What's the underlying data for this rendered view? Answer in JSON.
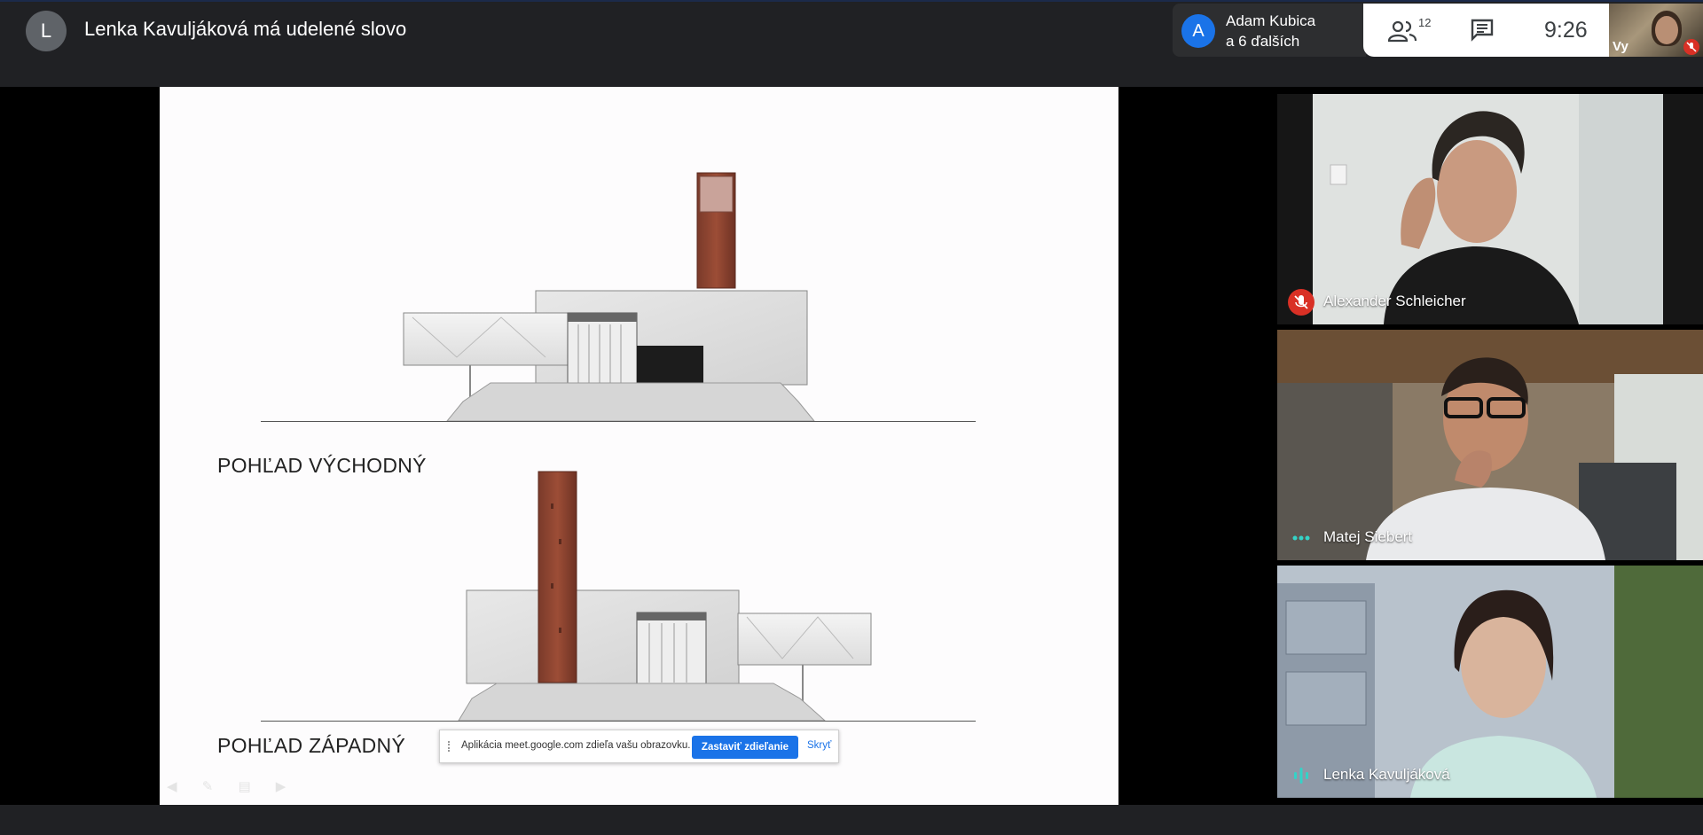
{
  "topbar": {
    "presenter_initial": "L",
    "presenter_text": "Lenka Kavuljáková má udelené slovo",
    "participants_avatar_initial": "A",
    "participants_name": "Adam Kubica",
    "participants_others": "a 6 ďalších",
    "people_count": "12",
    "clock": "9:26",
    "self_label": "Vy"
  },
  "slide": {
    "label_east": "POHĽAD VÝCHODNÝ",
    "label_west": "POHĽAD ZÁPADNÝ"
  },
  "share_bar": {
    "message": "Aplikácia meet.google.com zdieľa vašu obrazovku.",
    "stop_label": "Zastaviť zdieľanie",
    "hide_label": "Skryť"
  },
  "tiles": [
    {
      "name": "Alexander Schleicher",
      "status": "muted"
    },
    {
      "name": "Matej Siebert",
      "status": "idle"
    },
    {
      "name": "Lenka Kavuljáková",
      "status": "speaking"
    }
  ],
  "colors": {
    "accent": "#1a73e8",
    "muted_red": "#d93025",
    "speaking_teal": "#34d3c7",
    "topbar_bg": "#202124"
  },
  "icons": [
    "people-icon",
    "chat-icon",
    "mic-off-icon",
    "more-dots-icon",
    "audio-wave-icon"
  ]
}
